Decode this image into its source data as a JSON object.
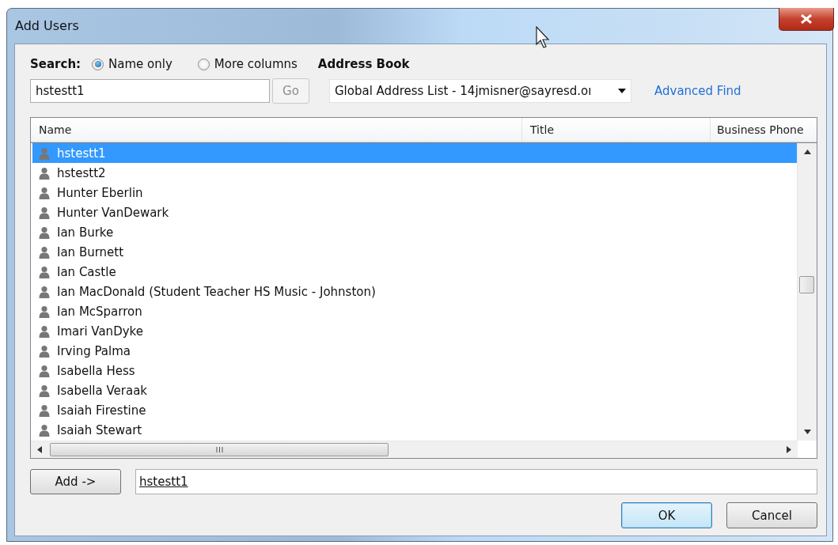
{
  "window": {
    "title": "Add Users"
  },
  "search": {
    "label": "Search:",
    "options": [
      {
        "label": "Name only",
        "selected": true
      },
      {
        "label": "More columns",
        "selected": false
      }
    ],
    "value": "hstestt1",
    "go_button": {
      "label": "Go",
      "disabled": true
    }
  },
  "address_book": {
    "label": "Address Book",
    "value": "Global Address List - 14jmisner@sayresd.oı",
    "link": "Advanced Find"
  },
  "table": {
    "columns": [
      "Name",
      "Title",
      "Business Phone"
    ],
    "rows": [
      {
        "name": "hstestt1",
        "selected": true
      },
      {
        "name": "hstestt2",
        "selected": false
      },
      {
        "name": "Hunter Eberlin",
        "selected": false
      },
      {
        "name": "Hunter VanDewark",
        "selected": false
      },
      {
        "name": "Ian Burke",
        "selected": false
      },
      {
        "name": "Ian Burnett",
        "selected": false
      },
      {
        "name": "Ian Castle",
        "selected": false
      },
      {
        "name": "Ian MacDonald (Student Teacher HS Music - Johnston)",
        "selected": false
      },
      {
        "name": "Ian McSparron",
        "selected": false
      },
      {
        "name": "Imari VanDyke",
        "selected": false
      },
      {
        "name": "Irving Palma",
        "selected": false
      },
      {
        "name": "Isabella Hess",
        "selected": false
      },
      {
        "name": "Isabella Veraak",
        "selected": false
      },
      {
        "name": "Isaiah Firestine",
        "selected": false
      },
      {
        "name": "Isaiah Stewart",
        "selected": false
      }
    ]
  },
  "add": {
    "button": "Add ->",
    "value": "hstestt1"
  },
  "buttons": [
    "OK",
    "Cancel"
  ]
}
